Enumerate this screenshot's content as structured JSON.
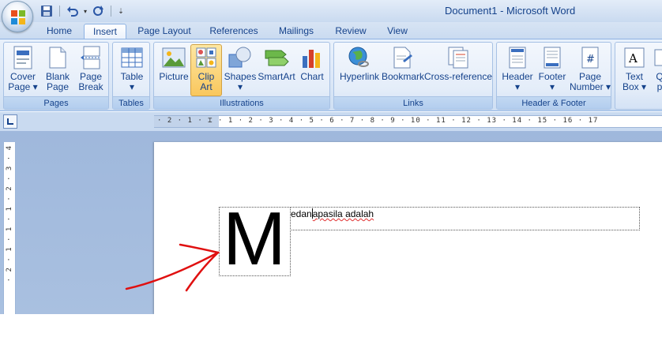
{
  "window": {
    "title": "Document1 - Microsoft Word"
  },
  "quick_access": [
    {
      "name": "save-icon"
    },
    {
      "name": "undo-icon"
    },
    {
      "name": "undo-dropdown-icon"
    },
    {
      "name": "redo-icon"
    },
    {
      "name": "customize-qat-icon"
    }
  ],
  "tabs": [
    {
      "label": "Home"
    },
    {
      "label": "Insert"
    },
    {
      "label": "Page Layout"
    },
    {
      "label": "References"
    },
    {
      "label": "Mailings"
    },
    {
      "label": "Review"
    },
    {
      "label": "View"
    }
  ],
  "ribbon": {
    "pages": {
      "label": "Pages",
      "cover_page": "Cover\nPage ▾",
      "blank_page": "Blank\nPage",
      "page_break": "Page\nBreak"
    },
    "tables": {
      "label": "Tables",
      "table": "Table\n▾"
    },
    "illustrations": {
      "label": "Illustrations",
      "picture": "Picture",
      "clip_art": "Clip\nArt",
      "shapes": "Shapes\n▾",
      "smartart": "SmartArt",
      "chart": "Chart"
    },
    "links": {
      "label": "Links",
      "hyperlink": "Hyperlink",
      "bookmark": "Bookmark",
      "cross_reference": "Cross-reference"
    },
    "header_footer": {
      "label": "Header & Footer",
      "header": "Header\n▾",
      "footer": "Footer\n▾",
      "page_number": "Page\nNumber ▾"
    },
    "text": {
      "text_box": "Text\nBox ▾",
      "quick_parts_partial": "Q\np"
    }
  },
  "ruler": {
    "horizontal": "· 2 · 1 · ⌶ · 1 · 2 · 3 · 4 · 5 · 6 · 7 · 8 · 9 · 10 · 11 · 12 · 13 · 14 · 15 · 16 · 17",
    "vertical": "· 2 · 1 · 1 · 1 · 2 · 3 · 4"
  },
  "document": {
    "drop_cap": "M",
    "text_before_cursor": "edan",
    "text_after_cursor": "apasila adalah"
  },
  "colors": {
    "ribbon_bg": "#dbe7f7",
    "selected_button": "#f9c75d",
    "annotation_arrow": "#e01010"
  }
}
